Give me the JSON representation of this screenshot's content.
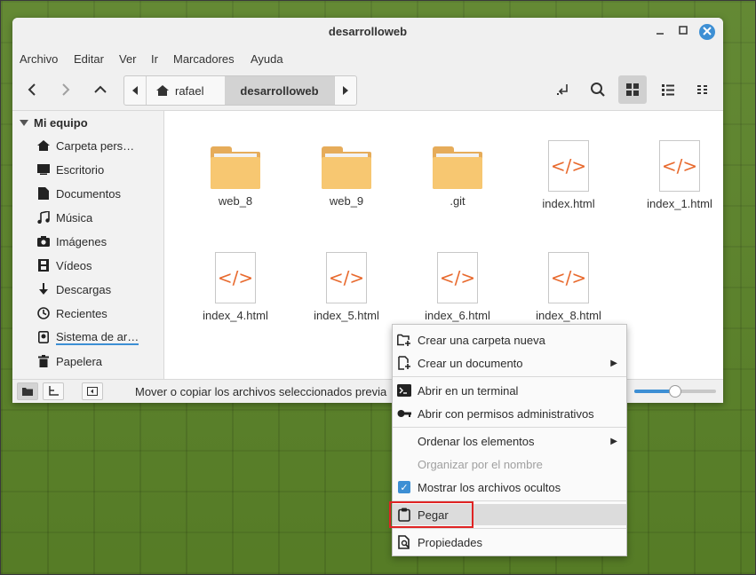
{
  "window": {
    "title": "desarrolloweb"
  },
  "menubar": [
    "Archivo",
    "Editar",
    "Ver",
    "Ir",
    "Marcadores",
    "Ayuda"
  ],
  "breadcrumb": {
    "home": "rafael",
    "current": "desarrolloweb"
  },
  "sidebar": {
    "header": "Mi equipo",
    "items": [
      {
        "label": "Carpeta pers…",
        "icon": "home-icon"
      },
      {
        "label": "Escritorio",
        "icon": "desktop-icon"
      },
      {
        "label": "Documentos",
        "icon": "document-icon"
      },
      {
        "label": "Música",
        "icon": "music-icon"
      },
      {
        "label": "Imágenes",
        "icon": "camera-icon"
      },
      {
        "label": "Vídeos",
        "icon": "film-icon"
      },
      {
        "label": "Descargas",
        "icon": "download-icon"
      },
      {
        "label": "Recientes",
        "icon": "clock-icon"
      },
      {
        "label": "Sistema de ar…",
        "icon": "drive-icon"
      },
      {
        "label": "Papelera",
        "icon": "trash-icon"
      }
    ]
  },
  "files": [
    {
      "name": "web_8",
      "type": "folder"
    },
    {
      "name": "web_9",
      "type": "folder"
    },
    {
      "name": ".git",
      "type": "folder"
    },
    {
      "name": "index.html",
      "type": "html"
    },
    {
      "name": "index_1.html",
      "type": "html"
    },
    {
      "name": "index_4.html",
      "type": "html"
    },
    {
      "name": "index_5.html",
      "type": "html"
    },
    {
      "name": "index_6.html",
      "type": "html"
    },
    {
      "name": "index_8.html",
      "type": "html"
    }
  ],
  "html_glyph": "</>",
  "status": {
    "text": "Mover o copiar los archivos seleccionados previa",
    "zoom_level": 0.5
  },
  "context_menu": {
    "groups": [
      [
        {
          "label": "Crear una carpeta nueva",
          "icon": "new-folder-icon",
          "submenu": false,
          "enabled": true
        },
        {
          "label": "Crear un documento",
          "icon": "new-document-icon",
          "submenu": true,
          "enabled": true
        }
      ],
      [
        {
          "label": "Abrir en un terminal",
          "icon": "terminal-icon",
          "submenu": false,
          "enabled": true
        },
        {
          "label": "Abrir con permisos administrativos",
          "icon": "key-icon",
          "submenu": false,
          "enabled": true
        }
      ],
      [
        {
          "label": "Ordenar los elementos",
          "icon": "",
          "submenu": true,
          "enabled": true
        },
        {
          "label": "Organizar por el nombre",
          "icon": "",
          "submenu": false,
          "enabled": false
        },
        {
          "label": "Mostrar los archivos ocultos",
          "icon": "checkbox-icon",
          "submenu": false,
          "enabled": true,
          "checked": true
        }
      ],
      [
        {
          "label": "Pegar",
          "icon": "clipboard-icon",
          "submenu": false,
          "enabled": true,
          "hovered": true
        }
      ],
      [
        {
          "label": "Propiedades",
          "icon": "properties-icon",
          "submenu": false,
          "enabled": true
        }
      ]
    ]
  },
  "colors": {
    "accent": "#3d8fd4",
    "desktop": "#5a8228",
    "folder": "#f7c771",
    "html_code": "#e86a2e",
    "highlight_box": "#e02424"
  }
}
